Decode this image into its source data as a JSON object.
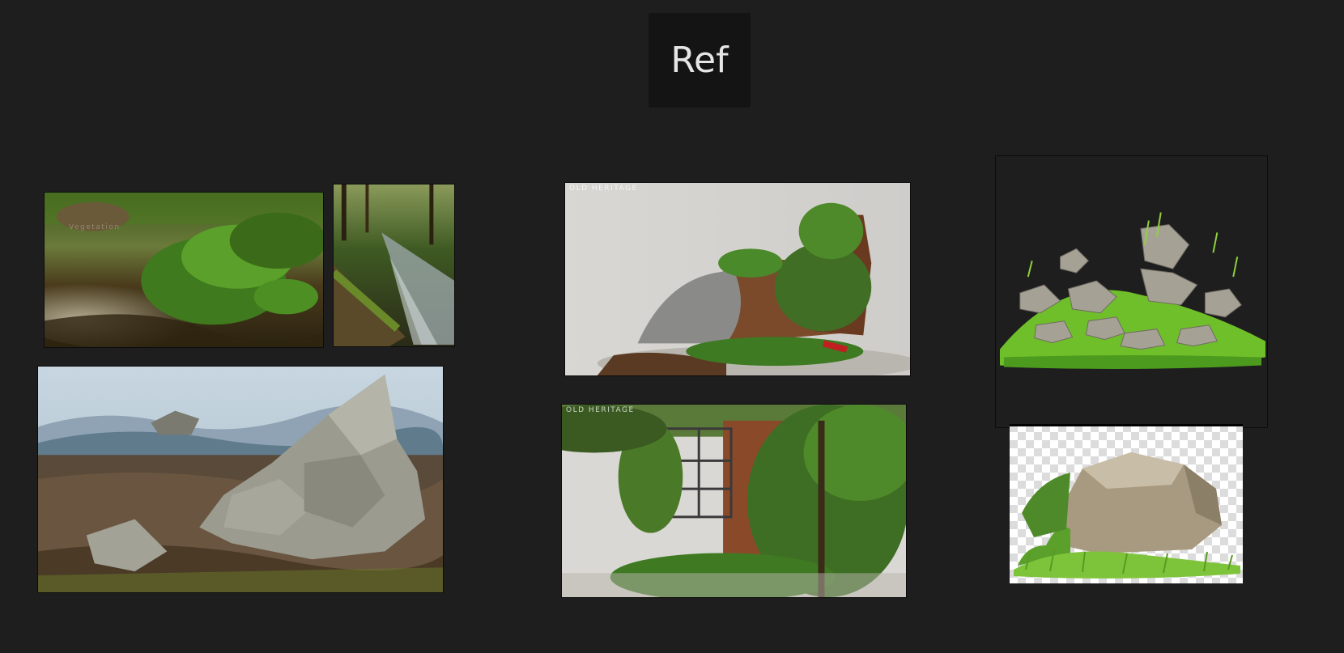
{
  "board": {
    "title": "Ref"
  },
  "images": {
    "stream_plants": {
      "alt": "Stream with green plants",
      "watermark": "Vegetation"
    },
    "forest_stream": {
      "alt": "Forest stream with mossy log"
    },
    "rocky_hills": {
      "alt": "Rocky outcrop on hills"
    },
    "brick_ruin": {
      "alt": "Overgrown brick ruin render",
      "watermark": "OLD HERITAGE"
    },
    "ivy_wall": {
      "alt": "Ivy covered wall render",
      "watermark": "OLD HERITAGE"
    },
    "rocks_grass": {
      "alt": "Rocks with grass on dark background"
    },
    "boulder_grass": {
      "alt": "Boulder with grass on transparency grid"
    }
  },
  "colors": {
    "background": "#1e1e1e",
    "title_card": "#141414",
    "title_text": "#e6e6e6"
  }
}
